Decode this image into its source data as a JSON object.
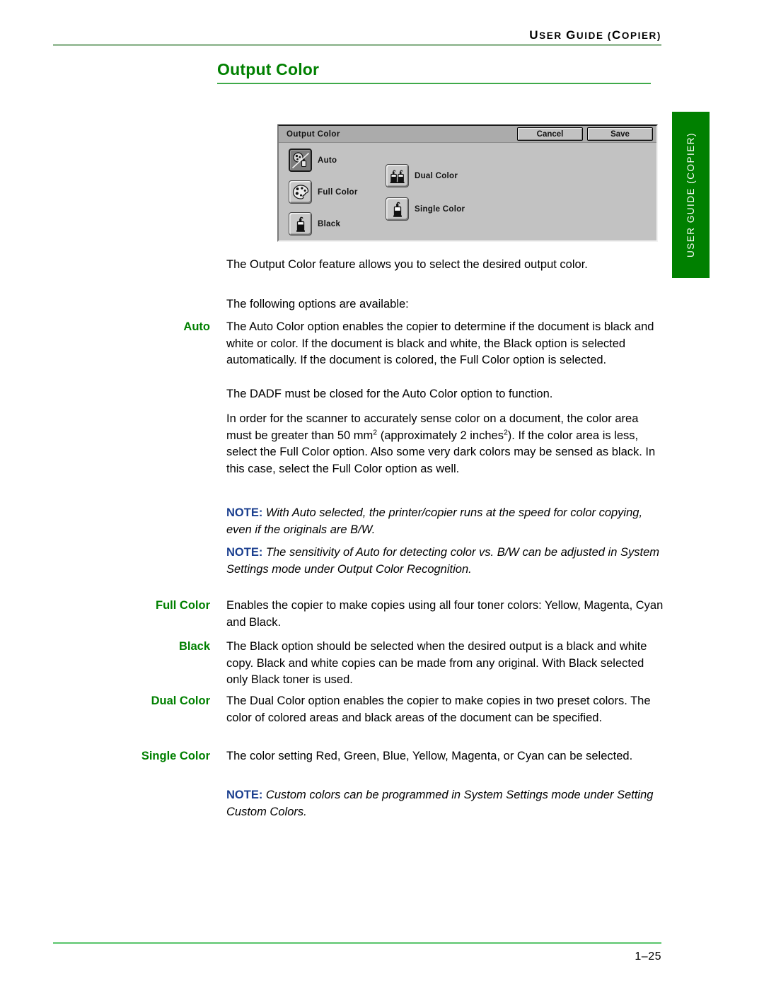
{
  "header": {
    "running_head": "USER GUIDE (COPIER)",
    "rule_color": "#9dbf9d"
  },
  "page_title": "Output Color",
  "side_tab": {
    "label": "USER GUIDE (COPIER)",
    "background_color": "#008000",
    "text_color": "#ffffff"
  },
  "ui_panel": {
    "title": "Output Color",
    "cancel_label": "Cancel",
    "save_label": "Save",
    "options": [
      {
        "label": "Auto",
        "icon": "auto-color-icon",
        "selected": true
      },
      {
        "label": "Full Color",
        "icon": "palette-icon",
        "selected": false
      },
      {
        "label": "Black",
        "icon": "toner-bottle-icon",
        "selected": false
      },
      {
        "label": "Dual Color",
        "icon": "two-toner-bottles-icon",
        "selected": false
      },
      {
        "label": "Single Color",
        "icon": "single-toner-bottle-icon",
        "selected": false
      }
    ]
  },
  "content": {
    "intro_1": "The Output Color feature allows you to select the desired output color.",
    "intro_2": "The following options are available:",
    "auto_term": "Auto",
    "auto_p1": "The Auto Color option enables the copier to determine if the document is black and white or color.  If the document is black and white, the Black option is selected automatically.  If the document is colored, the Full Color option is selected.",
    "auto_p2": "The DADF must be closed for the Auto Color option to function.",
    "auto_p3_a": "In order for the scanner to accurately sense color on a document, the color area must be greater than 50 mm",
    "auto_p3_sup1": "2",
    "auto_p3_b": " (approximately 2 inches",
    "auto_p3_sup2": "2",
    "auto_p3_c": ").  If the color area is less, select the Full Color option. Also some very dark colors may be sensed as black.  In this case, select the Full Color option as well.",
    "note_label": "NOTE:",
    "note_1": " With Auto selected, the printer/copier runs at the speed for color copying, even if the originals are B/W.",
    "note_2": " The sensitivity of Auto for detecting color vs. B/W can be adjusted in System Settings mode under Output Color Recognition.",
    "full_color_term": "Full Color",
    "full_color_body": "Enables the copier to make copies using all four toner colors: Yellow, Magenta, Cyan and Black.",
    "black_term": "Black",
    "black_body": "The Black option should be selected when the desired output is a black and white copy.  Black and white copies can be made from any original.  With Black selected only Black toner is used.",
    "dual_color_term": "Dual Color",
    "dual_color_body": "The Dual Color option enables the copier to make copies in two preset colors.  The color of colored areas and black areas of the document can be specified.",
    "single_color_term": "Single Color",
    "single_color_body": "The color setting Red, Green, Blue, Yellow, Magenta, or Cyan can be selected.",
    "note_3": " Custom colors can be programmed in System Settings mode under Setting Custom Colors."
  },
  "footer": {
    "page_number": "1–25",
    "rule_color": "#7bd18a"
  },
  "colors": {
    "heading_green": "#008000",
    "note_blue": "#1b3f8f"
  }
}
